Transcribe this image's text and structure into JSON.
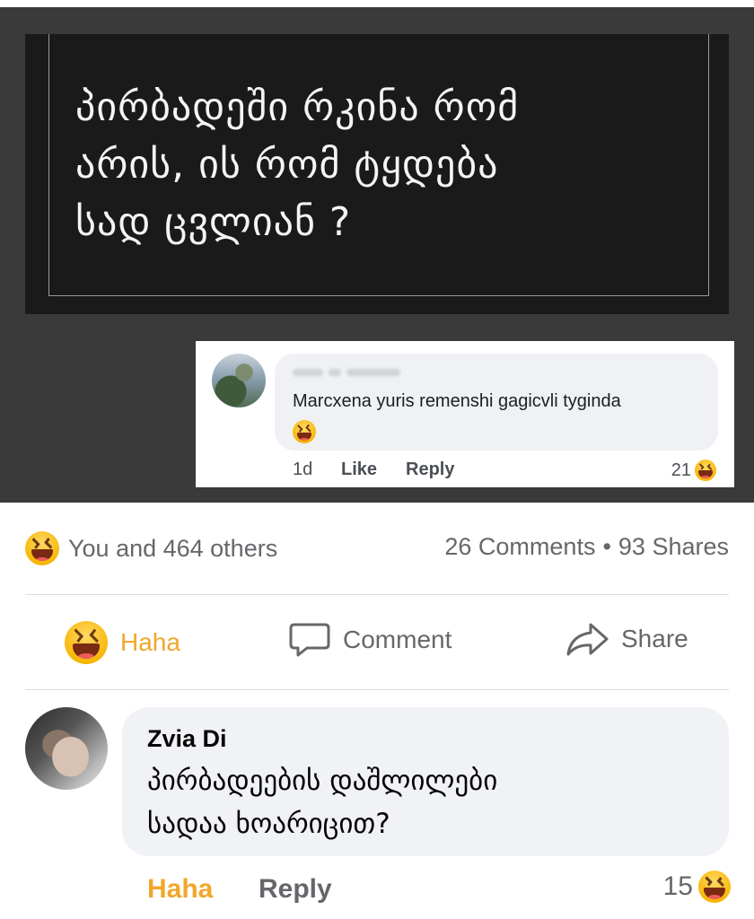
{
  "meme": {
    "lines": [
      "პირბადეში რკინა რომ",
      "არის, ის რომ ტყდება",
      "სად ცვლიან ?"
    ],
    "inset_comment": {
      "text": "Marcxena yuris remenshi gagicvli tyginda",
      "time": "1d",
      "like_label": "Like",
      "reply_label": "Reply",
      "reaction_count": "21"
    }
  },
  "summary": {
    "reactions_text": "You and 464 others",
    "comments_text": "26 Comments",
    "separator": "•",
    "shares_text": "93 Shares"
  },
  "actions": {
    "haha_label": "Haha",
    "comment_label": "Comment",
    "share_label": "Share"
  },
  "comment": {
    "author": "Zvia Di",
    "lines": [
      "პირბადეების დაშლილები",
      "სადაა ხოარიცით?"
    ],
    "haha_label": "Haha",
    "reply_label": "Reply",
    "reaction_count": "15"
  },
  "colors": {
    "haha_accent": "#f1a72a",
    "muted_text": "#65676b",
    "bubble": "#f0f2f5"
  }
}
